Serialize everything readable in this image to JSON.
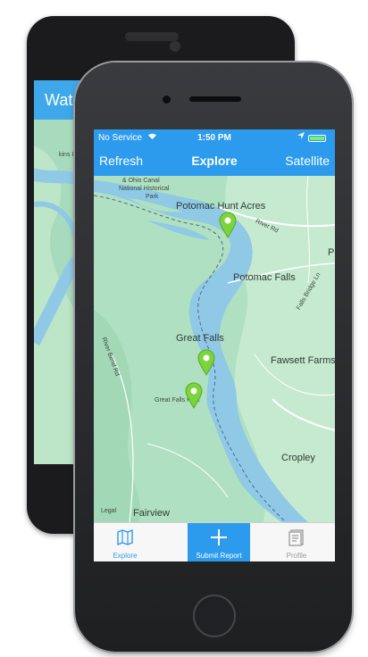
{
  "android": {
    "header_title": "Water",
    "map_label": "kins Island"
  },
  "ios": {
    "status": {
      "carrier": "No Service",
      "time": "1:50 PM"
    },
    "navbar": {
      "left": "Refresh",
      "title": "Explore",
      "right": "Satellite"
    },
    "map": {
      "labels": {
        "canal": "& Ohio Canal",
        "park1": "National Historical",
        "park2": "Park",
        "potomac_hunt": "Potomac Hunt Acres",
        "river_rd": "River Rd",
        "potomac_falls": "Potomac Falls",
        "great_falls": "Great Falls",
        "fawsett": "Fawsett Farms",
        "great_falls_park": "Great Falls Park",
        "river_bend": "River Bend Rd",
        "falls_bridge": "Falls Bridge Ln",
        "cropley": "Cropley",
        "fairview": "Fairview",
        "legal": "Legal",
        "p_letter": "P"
      },
      "pins": [
        "pin-potomac-hunt-acres",
        "pin-great-falls-1",
        "pin-great-falls-2"
      ],
      "pin_color": "#7bd43a"
    },
    "tabs": {
      "explore": "Explore",
      "submit": "Submit Report",
      "profile": "Profile"
    }
  },
  "colors": {
    "accent": "#2c9bee",
    "map_green": "#ade0c0",
    "river": "#8fc9e6"
  }
}
